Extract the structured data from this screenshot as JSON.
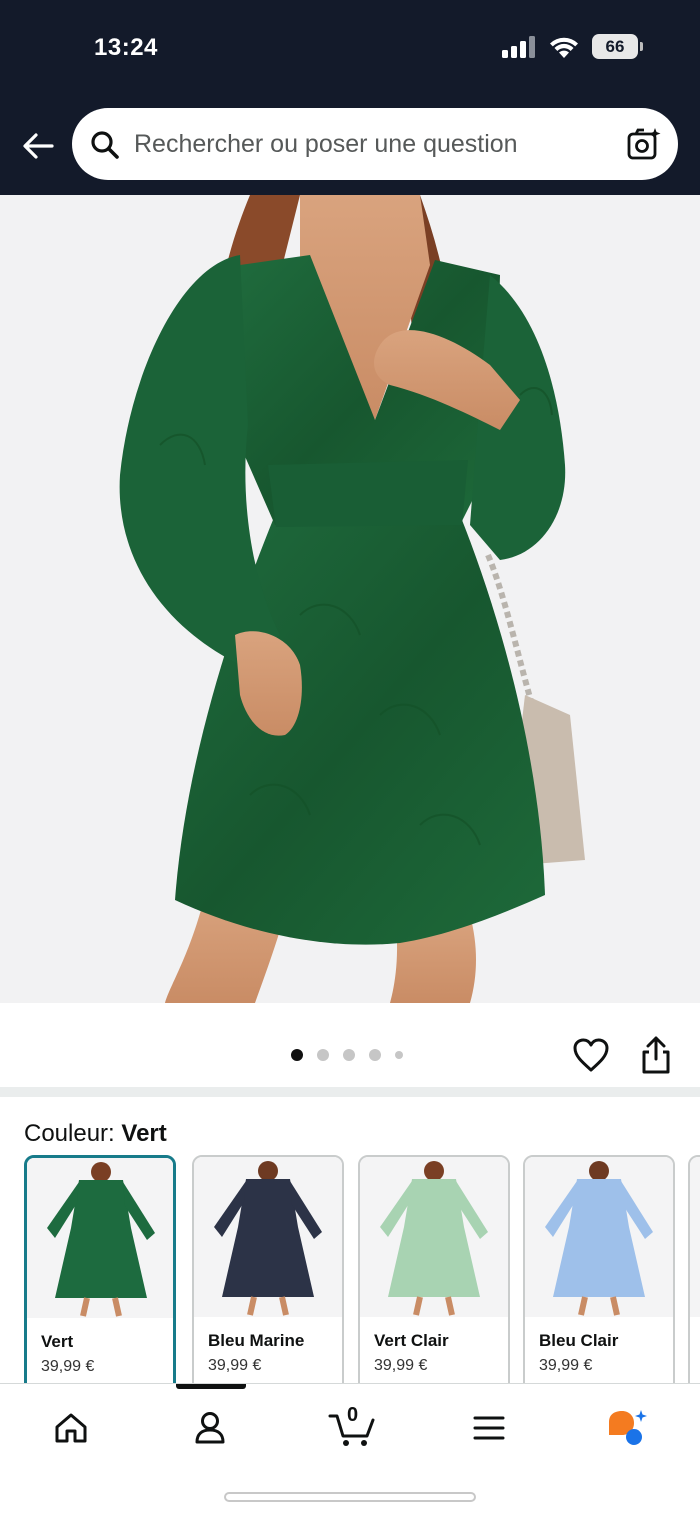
{
  "status_bar": {
    "time": "13:24",
    "battery": "66",
    "icons": [
      "signal-icon",
      "wifi-icon",
      "battery-icon"
    ]
  },
  "header": {
    "back_icon": "back-arrow-icon",
    "search_placeholder": "Rechercher ou poser une question",
    "search_icon": "search-icon",
    "camera_icon": "camera-search-icon"
  },
  "product_image": {
    "description_icon": "green-dress-photo",
    "gallery_count": 5,
    "gallery_active_index": 0
  },
  "image_actions": {
    "wishlist_icon": "heart-icon",
    "share_icon": "share-icon"
  },
  "color_selector": {
    "label": "Couleur: ",
    "selected": "Vert",
    "options": [
      {
        "name": "Vert",
        "price": "39,99 €",
        "color": "#1d6b3f",
        "selected": true
      },
      {
        "name": "Bleu Marine",
        "price": "39,99 €",
        "color": "#2c3347",
        "selected": false
      },
      {
        "name": "Vert Clair",
        "price": "39,99 €",
        "color": "#a8d3b2",
        "selected": false
      },
      {
        "name": "Bleu Clair",
        "price": "39,99 €",
        "color": "#9ec0ea",
        "selected": false
      }
    ]
  },
  "bottom_nav": {
    "items": [
      "home-icon",
      "account-icon",
      "cart-icon",
      "menu-icon",
      "rufus-assistant-icon"
    ],
    "cart_count": "0",
    "active_index": 1
  },
  "colors": {
    "header_bg": "#131a2a",
    "selected_border": "#177b8a",
    "accent_orange": "#f47b20",
    "accent_blue": "#1a73e8"
  }
}
